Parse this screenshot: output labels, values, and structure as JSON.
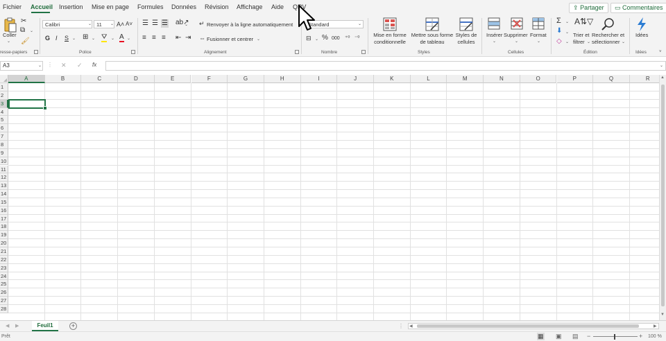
{
  "tabs": {
    "items": [
      "Fichier",
      "Accueil",
      "Insertion",
      "Mise en page",
      "Formules",
      "Données",
      "Révision",
      "Affichage",
      "Aide",
      "QRV"
    ],
    "active": "Accueil",
    "share_label": "Partager",
    "comments_label": "Commentaires"
  },
  "ribbon": {
    "clipboard": {
      "paste_label": "Coller",
      "group_label": "resse-papiers"
    },
    "font": {
      "font_name": "Calibri",
      "font_size": "11",
      "bold": "G",
      "italic": "I",
      "underline": "S",
      "group_label": "Police"
    },
    "alignment": {
      "wrap_label": "Renvoyer à la ligne automatiquement",
      "merge_label": "Fusionner et centrer",
      "group_label": "Alignement"
    },
    "number": {
      "format": "Standard",
      "percent": "%",
      "thousands": "000",
      "group_label": "Nombre"
    },
    "styles": {
      "cond_format_l1": "Mise en forme",
      "cond_format_l2": "conditionnelle",
      "table_format_l1": "Mettre sous forme",
      "table_format_l2": "de tableau",
      "cell_styles_l1": "Styles de",
      "cell_styles_l2": "cellules",
      "group_label": "Styles"
    },
    "cells": {
      "insert": "Insérer",
      "delete": "Supprimer",
      "format": "Format",
      "group_label": "Cellules"
    },
    "editing": {
      "sort_l1": "Trier et",
      "sort_l2": "filtrer",
      "find_l1": "Rechercher et",
      "find_l2": "sélectionner",
      "group_label": "Édition"
    },
    "ideas": {
      "label": "Idées",
      "group_label": "Idées"
    }
  },
  "formula_bar": {
    "name_box": "A3",
    "fx": "fx",
    "formula": ""
  },
  "grid": {
    "columns": [
      "A",
      "B",
      "C",
      "D",
      "E",
      "F",
      "G",
      "H",
      "I",
      "J",
      "K",
      "L",
      "M",
      "N",
      "O",
      "P",
      "Q",
      "R"
    ],
    "rows": [
      "1",
      "2",
      "3",
      "4",
      "5",
      "6",
      "7",
      "8",
      "9",
      "10",
      "11",
      "12",
      "13",
      "14",
      "15",
      "16",
      "17",
      "18",
      "19",
      "20",
      "21",
      "22",
      "23",
      "24",
      "25",
      "26",
      "27",
      "28"
    ],
    "active_cell": "A3"
  },
  "sheets": {
    "tabs": [
      "Feuil1"
    ],
    "add_label": "+"
  },
  "status": {
    "left": "Prêt",
    "zoom": "100 %"
  },
  "colors": {
    "accent": "#217346",
    "ribbon_bg": "#f3f3f3",
    "ideas": "#2b7cd3"
  }
}
